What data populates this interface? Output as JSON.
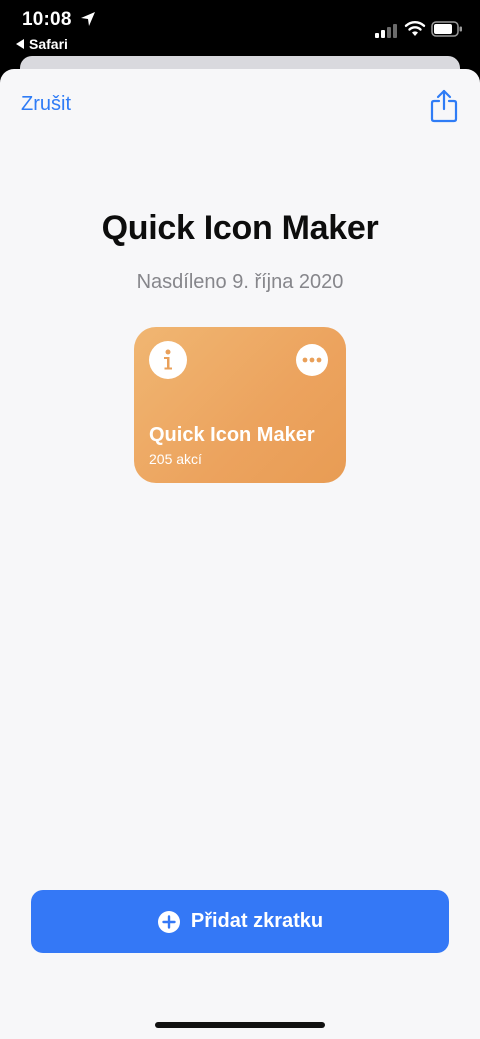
{
  "status_bar": {
    "time": "10:08",
    "back_app_label": "Safari",
    "icons": [
      "location-arrow-icon",
      "signal-icon",
      "wifi-icon",
      "battery-icon"
    ]
  },
  "nav": {
    "cancel_label": "Zrušit",
    "share_icon": "share-icon"
  },
  "shortcut": {
    "title": "Quick Icon Maker",
    "shared_date": "Nasdíleno 9. října 2020",
    "card_title": "Quick Icon Maker",
    "card_actions": "205 akcí",
    "card_color": "#eca35e",
    "info_icon": "info-icon",
    "more_icon": "more-icon"
  },
  "actions": {
    "add_label": "Přidat zkratku",
    "add_icon": "plus-circle-icon",
    "accent_color": "#3478f6"
  }
}
